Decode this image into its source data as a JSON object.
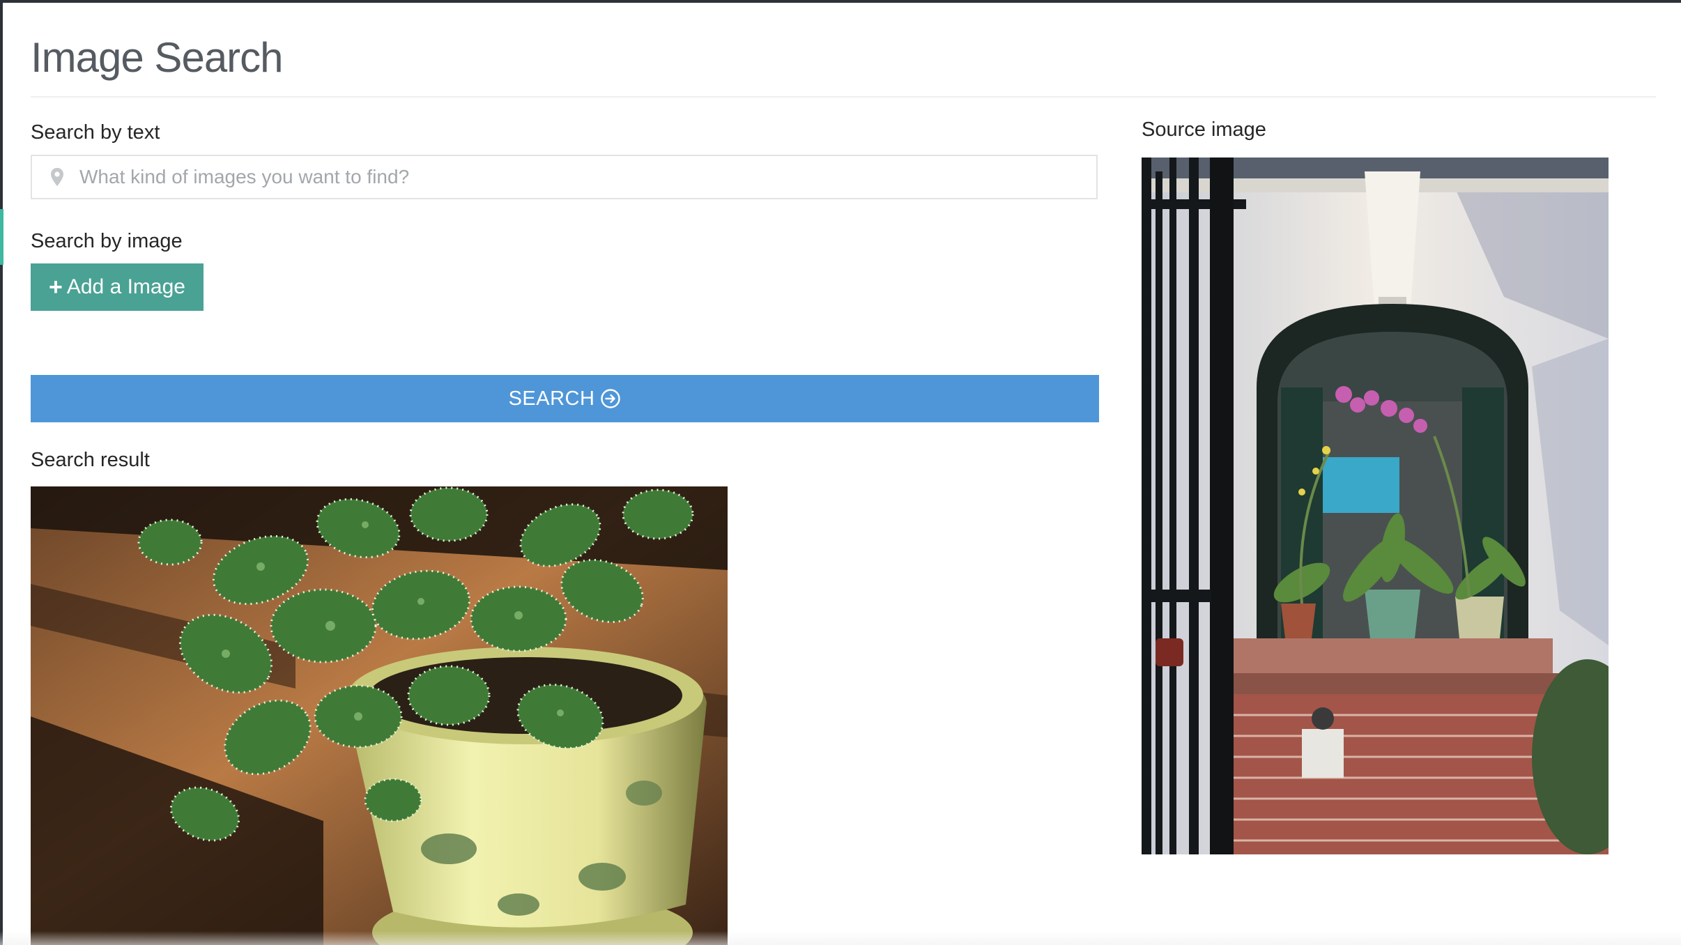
{
  "page": {
    "title": "Image Search"
  },
  "text_search": {
    "label": "Search by text",
    "placeholder": "What kind of images you want to find?",
    "value": "",
    "icon": "map-pin-icon"
  },
  "image_search": {
    "label": "Search by image",
    "add_button_label": "Add a Image",
    "add_button_icon": "plus-icon",
    "add_button_color": "#4aa294"
  },
  "search_button": {
    "label": "SEARCH",
    "icon": "arrow-circle-right-icon",
    "color": "#4f96d8"
  },
  "result": {
    "label": "Search result",
    "image_subject": "potted plant"
  },
  "source": {
    "label": "Source image",
    "image_subject": "window with orchids"
  }
}
